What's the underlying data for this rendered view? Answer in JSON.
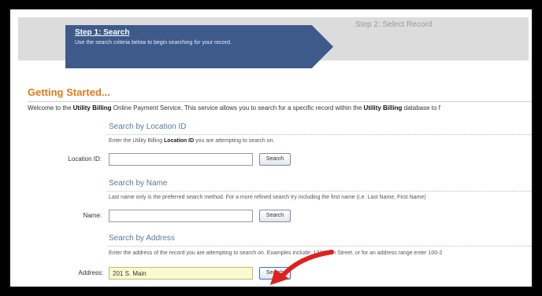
{
  "steps": {
    "step1_title": "Step 1: Search",
    "step1_desc": "Use the search criteria below to begin searching for your record.",
    "step2_title": "Step 2: Select Record"
  },
  "heading": "Getting Started...",
  "welcome": {
    "pre": "Welcome to the ",
    "b1": "Utility Billing",
    "mid": " Online Payment Service. This service allows you to search for a specific record within the ",
    "b2": "Utility Billing",
    "post": " database to f"
  },
  "location": {
    "title": "Search by Location ID",
    "desc_pre": "Enter the Utility Billing ",
    "desc_b": "Location ID",
    "desc_post": " you are attempting to search on.",
    "label": "Location ID:",
    "value": "",
    "button": "Search"
  },
  "name": {
    "title": "Search by Name",
    "desc": "Last name only is the preferred search method. For a more refined search try including the first name (i.e. Last Name, First Name)",
    "label": "Name:",
    "value": "",
    "button": "Search"
  },
  "address": {
    "title": "Search by Address",
    "desc": "Enter the address of the record you are attempting to search on. Examples include: 123 Main Street, or for an address range enter 100-2",
    "label": "Address:",
    "value": "201 S. Main",
    "button": "Search"
  },
  "colors": {
    "accent": "#e07a1a",
    "step_active": "#3d5a8a",
    "section_title": "#5a7aa0",
    "arrow": "#e0201f",
    "input_highlight": "#fbfbd2"
  },
  "icons": {
    "annotation": "red-arrow-icon"
  }
}
